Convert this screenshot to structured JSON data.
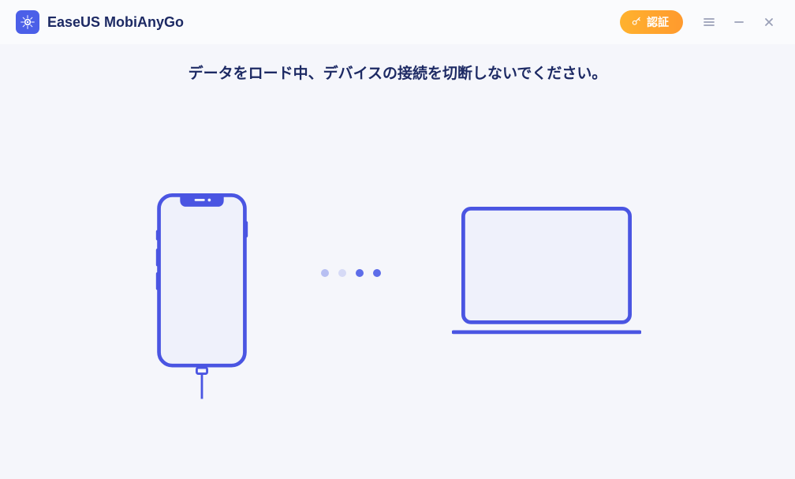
{
  "app": {
    "title": "EaseUS MobiAnyGo"
  },
  "header": {
    "auth_label": "認証"
  },
  "main": {
    "status_message": "データをロード中、デバイスの接続を切断しないでください。"
  }
}
